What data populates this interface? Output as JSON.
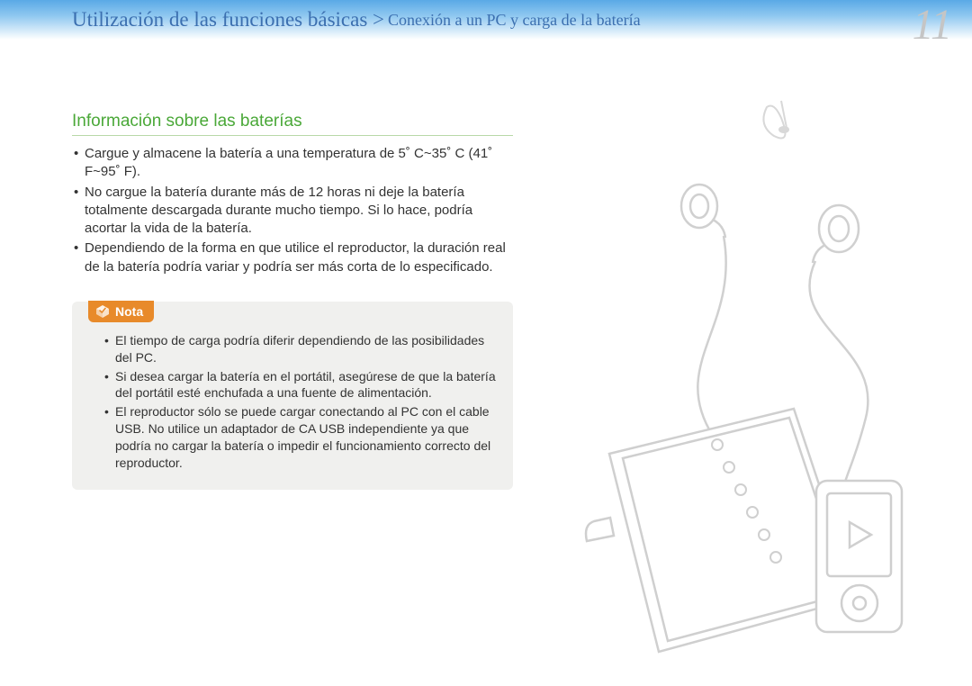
{
  "header": {
    "breadcrumb_main": "Utilización de las funciones básicas >",
    "breadcrumb_sub": "Conexión a un PC y carga de la batería",
    "page_number": "11"
  },
  "section": {
    "title": "Información sobre las baterías",
    "bullets": [
      "Cargue y almacene la batería a una temperatura de 5˚ C~35˚ C (41˚ F~95˚ F).",
      "No cargue la batería durante más de 12 horas ni deje la batería totalmente descargada durante mucho tiempo. Si lo hace, podría acortar la vida de la batería.",
      "Dependiendo de la forma en que utilice el reproductor, la duración real de la batería podría variar y podría ser más corta de lo especificado."
    ]
  },
  "note": {
    "label": "Nota",
    "bullets": [
      "El tiempo de carga podría diferir dependiendo de las posibilidades del PC.",
      "Si desea cargar la batería en el portátil, asegúrese de que la batería del portátil esté enchufada a una fuente de alimentación.",
      "El reproductor sólo se puede cargar conectando al PC con el cable USB. No utilice un adaptador de CA USB independiente ya que podría no cargar la batería o impedir el funcionamiento correcto del reproductor."
    ]
  }
}
